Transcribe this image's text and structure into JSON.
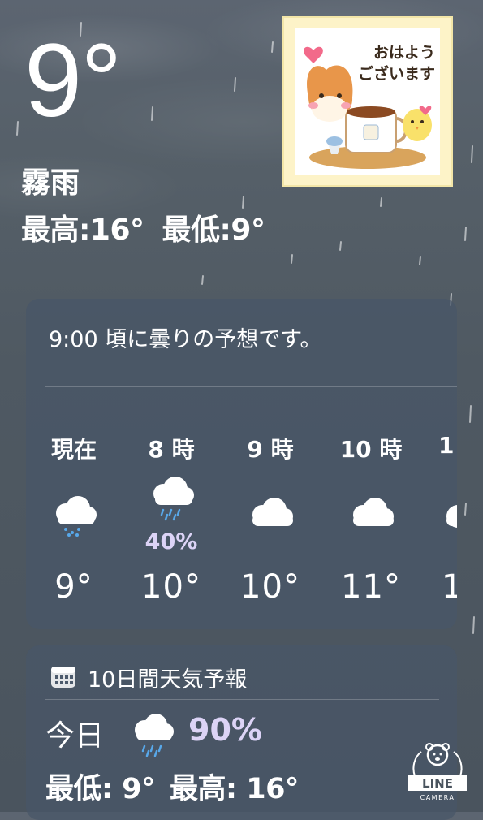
{
  "current": {
    "temperature": "9°",
    "condition": "霧雨",
    "high": "最高:16°",
    "low": "最低:9°"
  },
  "sticker": {
    "line1": "おはよう",
    "line2": "ございます"
  },
  "hourly": {
    "summary": "9:00 頃に曇りの予想です。",
    "items": [
      {
        "label": "現在",
        "icon": "drizzle-cloud-icon",
        "precip": "",
        "temp": "9°"
      },
      {
        "label": "8 時",
        "icon": "rain-cloud-icon",
        "precip": "40%",
        "temp": "10°"
      },
      {
        "label": "9 時",
        "icon": "cloud-icon",
        "precip": "",
        "temp": "10°"
      },
      {
        "label": "10 時",
        "icon": "cloud-icon",
        "precip": "",
        "temp": "11°"
      },
      {
        "label": "1",
        "icon": "cloud-icon",
        "precip": "",
        "temp": "1"
      }
    ]
  },
  "daily": {
    "title": "10日間天気予報",
    "today": {
      "label": "今日",
      "icon": "rain-cloud-icon",
      "precip": "90%",
      "low": "最低: 9°",
      "high": "最高: 16°"
    }
  },
  "watermark": {
    "brand": "LINE",
    "product": "CAMERA"
  },
  "colors": {
    "precip_text": "#dcd3f6",
    "rain_drop": "#58a8ea",
    "card_bg": "#485668"
  }
}
